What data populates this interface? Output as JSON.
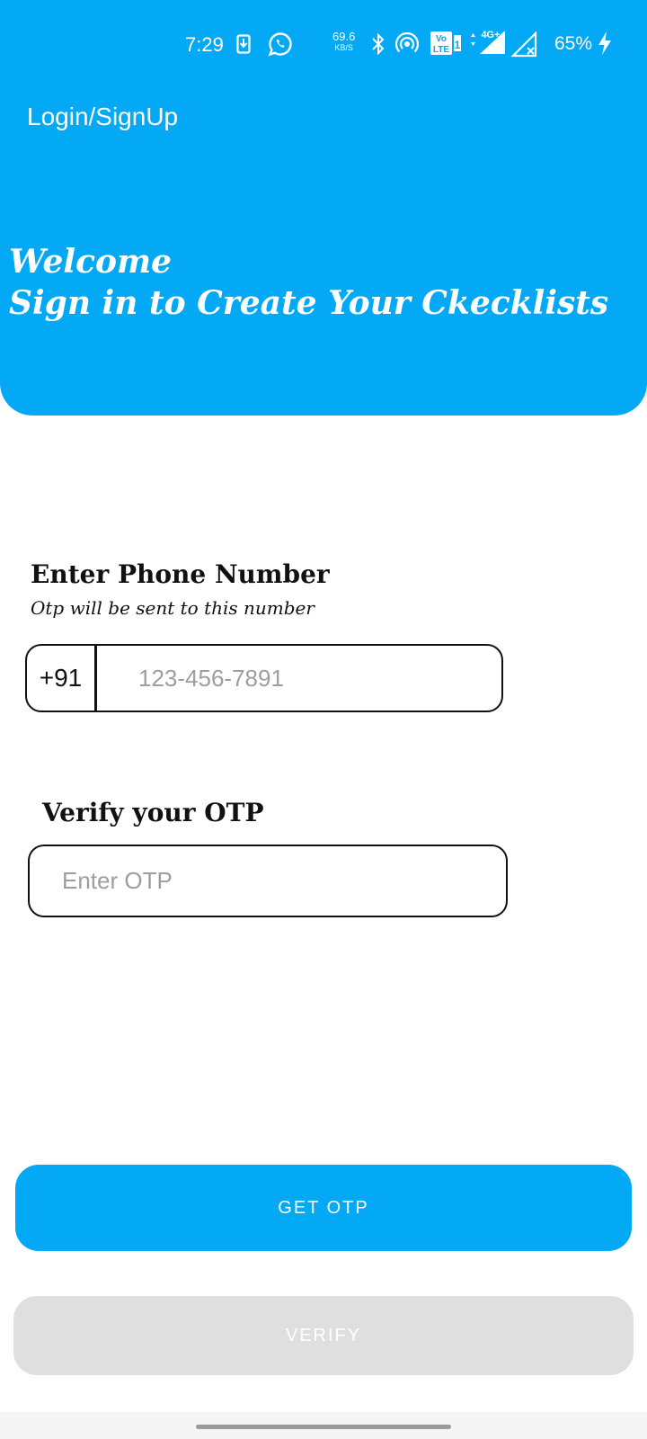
{
  "status_bar": {
    "time": "7:29",
    "net_speed": "69.6",
    "net_unit": "KB/S",
    "volte_label": "Vo LTE 1",
    "network_label": "4G+",
    "battery": "65%",
    "icons": [
      "download-icon",
      "whatsapp-icon",
      "bluetooth-icon",
      "hotspot-icon",
      "volte-icon",
      "signal-icon",
      "no-signal-icon",
      "charging-icon"
    ]
  },
  "header": {
    "title": "Login/SignUp",
    "welcome_line1": "Welcome",
    "welcome_line2": "Sign in to Create Your Ckecklists"
  },
  "phone_section": {
    "title": "Enter Phone Number",
    "subtitle": "Otp will be sent to this number",
    "country_code": "+91",
    "placeholder": "123-456-7891",
    "value": ""
  },
  "otp_section": {
    "title": "Verify your OTP",
    "placeholder": "Enter OTP",
    "value": ""
  },
  "buttons": {
    "get_otp": "GET OTP",
    "verify": "VERIFY"
  },
  "colors": {
    "primary": "#03A9F4",
    "disabled": "#dfdfdf",
    "text": "#111111"
  }
}
